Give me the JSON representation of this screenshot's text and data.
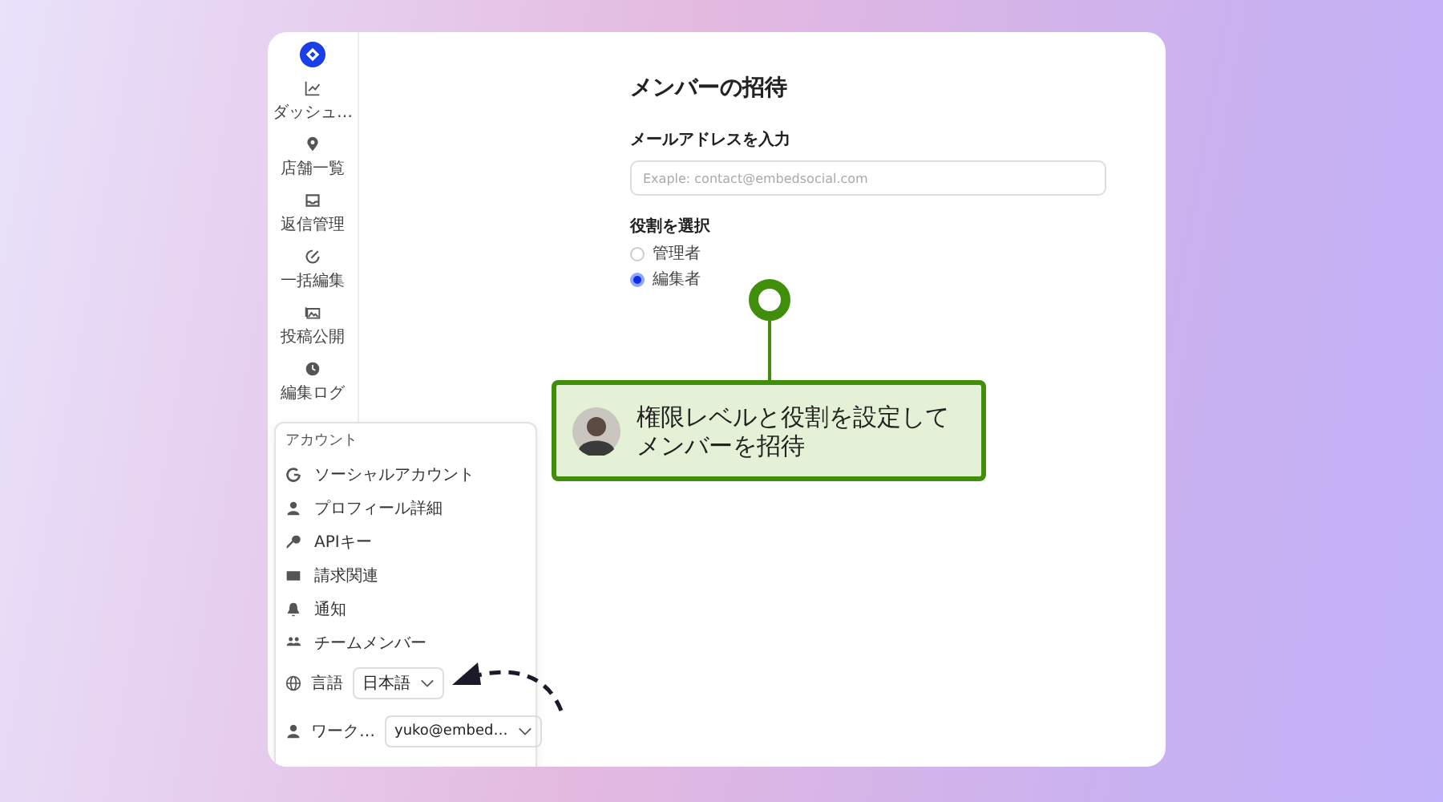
{
  "sidebar": {
    "items": [
      {
        "label": "ダッシュ…",
        "selected": false
      },
      {
        "label": "店舗一覧",
        "selected": false
      },
      {
        "label": "返信管理",
        "selected": false
      },
      {
        "label": "一括編集",
        "selected": false
      },
      {
        "label": "投稿公開",
        "selected": false
      },
      {
        "label": "編集ログ",
        "selected": false
      }
    ]
  },
  "page": {
    "title": "メンバーの招待",
    "email": {
      "label": "メールアドレスを入力",
      "placeholder": "Exaple: contact@embedsocial.com"
    },
    "role": {
      "label": "役割を選択",
      "options": [
        {
          "label": "管理者",
          "selected": false
        },
        {
          "label": "編集者",
          "selected": true
        }
      ]
    }
  },
  "account_menu": {
    "heading": "アカウント",
    "items": [
      {
        "label": "ソーシャルアカウント"
      },
      {
        "label": "プロフィール詳細"
      },
      {
        "label": "APIキー"
      },
      {
        "label": "請求関連"
      },
      {
        "label": "通知"
      },
      {
        "label": "チームメンバー"
      }
    ],
    "language": {
      "label": "言語",
      "value": "日本語"
    },
    "workspace": {
      "label": "ワーク…",
      "value": "yuko@embed…"
    }
  },
  "callout": {
    "lines": [
      "権限レベルと役割を設定して",
      "メンバーを招待"
    ]
  }
}
